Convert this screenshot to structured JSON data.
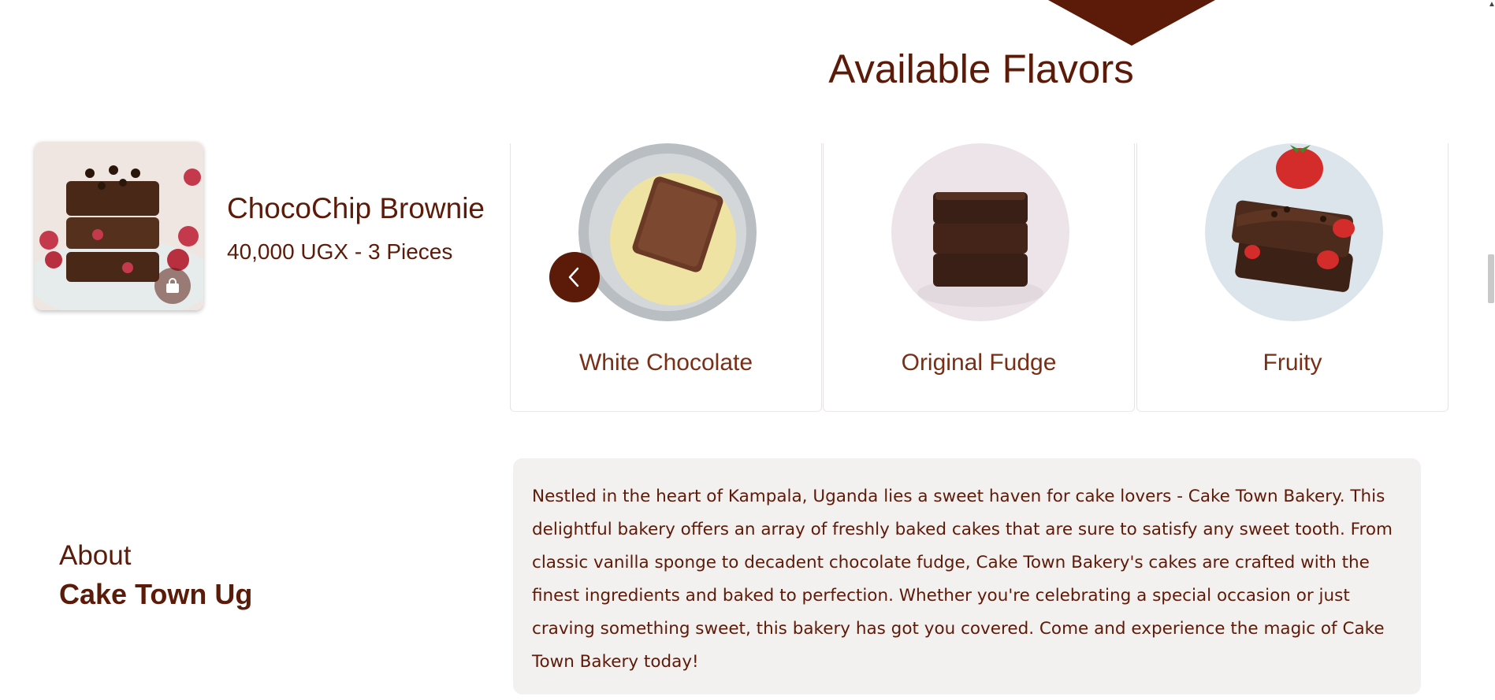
{
  "flavors_section": {
    "title": "Available Flavors",
    "items": [
      {
        "label": "White Chocolate",
        "icon": "white-chocolate-brownie-image"
      },
      {
        "label": "Original Fudge",
        "icon": "original-fudge-brownie-image"
      },
      {
        "label": "Fruity",
        "icon": "fruity-brownie-image"
      }
    ],
    "prev_icon": "chevron-left-icon"
  },
  "product": {
    "name": "ChocoChip Brownie",
    "price": "40,000 UGX - 3 Pieces",
    "cart_icon": "shopping-bag-icon"
  },
  "about": {
    "label": "About",
    "brand": "Cake Town Ug",
    "text": "Nestled in the heart of Kampala, Uganda lies a sweet haven for cake lovers - Cake Town Bakery. This delightful bakery offers an array of freshly baked cakes that are sure to satisfy any sweet tooth. From classic vanilla sponge to decadent chocolate fudge, Cake Town Bakery's cakes are crafted with the finest ingredients and baked to perfection. Whether you're celebrating a special occasion or just craving something sweet, this bakery has got you covered. Come and experience the magic of Cake Town Bakery today!"
  },
  "colors": {
    "brand": "#5c1a08",
    "about_bg": "#f3f0f0"
  }
}
